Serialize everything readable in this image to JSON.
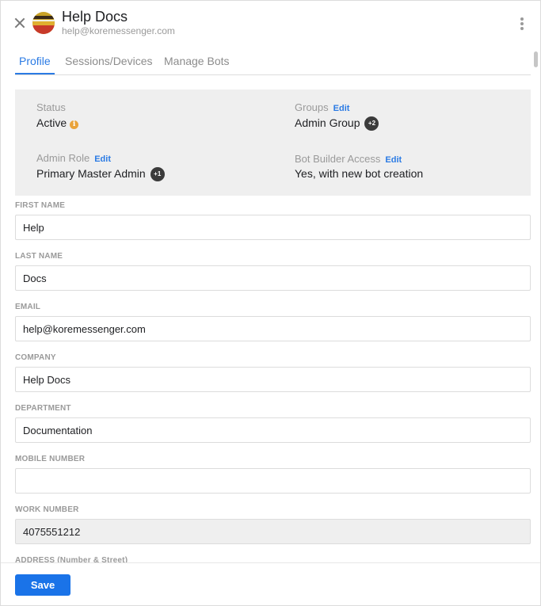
{
  "header": {
    "title": "Help Docs",
    "email": "help@koremessenger.com"
  },
  "tabs": [
    {
      "label": "Profile",
      "active": true
    },
    {
      "label": "Sessions/Devices",
      "active": false
    },
    {
      "label": "Manage Bots",
      "active": false
    }
  ],
  "info": {
    "status_label": "Status",
    "status_value": "Active",
    "groups_label": "Groups",
    "groups_edit": "Edit",
    "groups_value": "Admin Group",
    "groups_badge": "+2",
    "admin_role_label": "Admin Role",
    "admin_role_edit": "Edit",
    "admin_role_value": "Primary Master Admin",
    "admin_role_badge": "+1",
    "bot_builder_label": "Bot Builder Access",
    "bot_builder_edit": "Edit",
    "bot_builder_value": "Yes, with new bot creation"
  },
  "fields": {
    "first_name": {
      "label": "FIRST NAME",
      "value": "Help"
    },
    "last_name": {
      "label": "LAST NAME",
      "value": "Docs"
    },
    "email": {
      "label": "EMAIL",
      "value": "help@koremessenger.com"
    },
    "company": {
      "label": "COMPANY",
      "value": "Help Docs"
    },
    "department": {
      "label": "DEPARTMENT",
      "value": "Documentation"
    },
    "mobile_number": {
      "label": "MOBILE NUMBER",
      "value": ""
    },
    "work_number": {
      "label": "WORK NUMBER",
      "value": "4075551212"
    },
    "address": {
      "label": "ADDRESS (Number & Street)"
    }
  },
  "footer": {
    "save_label": "Save"
  },
  "colors": {
    "accent": "#2b7be4",
    "save_button": "#1a73e8",
    "status_icon": "#e9a33a"
  }
}
